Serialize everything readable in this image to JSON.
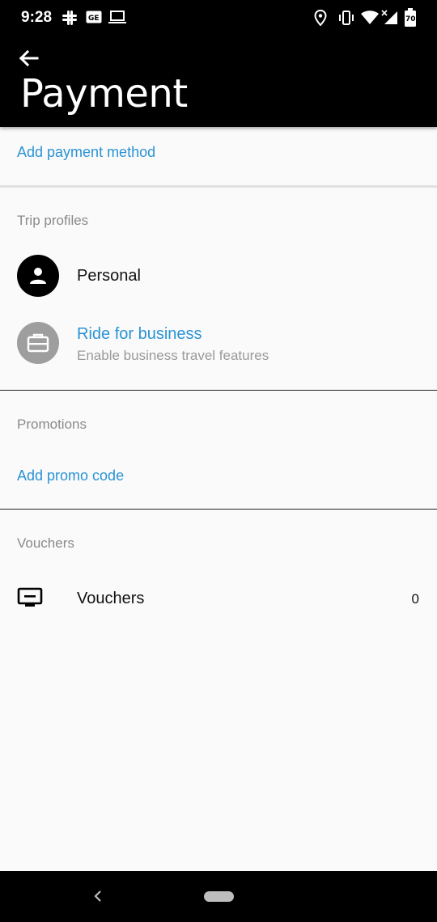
{
  "status_bar": {
    "time": "9:28",
    "battery": "70",
    "icons": [
      "slack-icon",
      "news-icon",
      "laptop-icon",
      "location-icon",
      "vibrate-icon",
      "wifi-icon",
      "signal-icon",
      "battery-icon"
    ]
  },
  "app_bar": {
    "title": "Payment",
    "back_icon": "arrow-left-icon"
  },
  "payment": {
    "add_method_label": "Add payment method"
  },
  "trip_profiles": {
    "header": "Trip profiles",
    "personal_label": "Personal",
    "business_title": "Ride for business",
    "business_subtitle": "Enable business travel features"
  },
  "promotions": {
    "header": "Promotions",
    "add_promo_label": "Add promo code"
  },
  "vouchers": {
    "header": "Vouchers",
    "row_label": "Vouchers",
    "count": "0"
  },
  "colors": {
    "link": "#2a93d5",
    "header_text": "#8a8a8a",
    "business_icon_bg": "#9e9e9e"
  }
}
